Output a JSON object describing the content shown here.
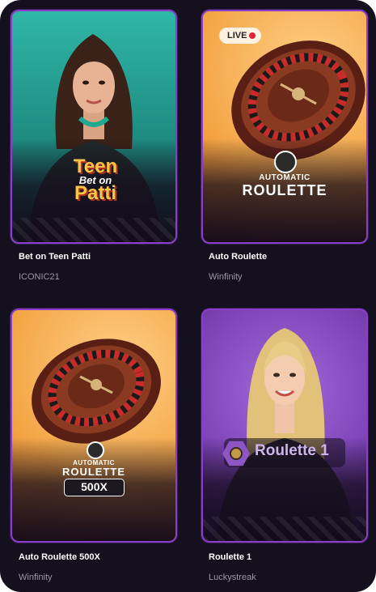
{
  "games": [
    {
      "title": "Bet on Teen Patti",
      "provider": "ICONIC21",
      "art": {
        "line1": "Teen",
        "line2": "Bet on",
        "line3": "Patti"
      }
    },
    {
      "title": "Auto Roulette",
      "provider": "Winfinity",
      "badge": "LIVE",
      "art": {
        "small": "AUTOMATIC",
        "main": "ROULETTE"
      }
    },
    {
      "title": "Auto Roulette 500X",
      "provider": "Winfinity",
      "art": {
        "small": "AUTOMATIC",
        "main": "ROULETTE",
        "multiplier": "500X"
      }
    },
    {
      "title": "Roulette 1",
      "provider": "Luckystreak",
      "art": {
        "main": "Roulette 1"
      }
    }
  ],
  "colors": {
    "card_border": "#8a3ec9",
    "background": "#15101e",
    "live_dot": "#e3223a",
    "provider_text": "#9b95a6"
  },
  "icons": [
    "roulette-chip-icon",
    "live-dot-icon",
    "hexagon-logo-icon"
  ]
}
